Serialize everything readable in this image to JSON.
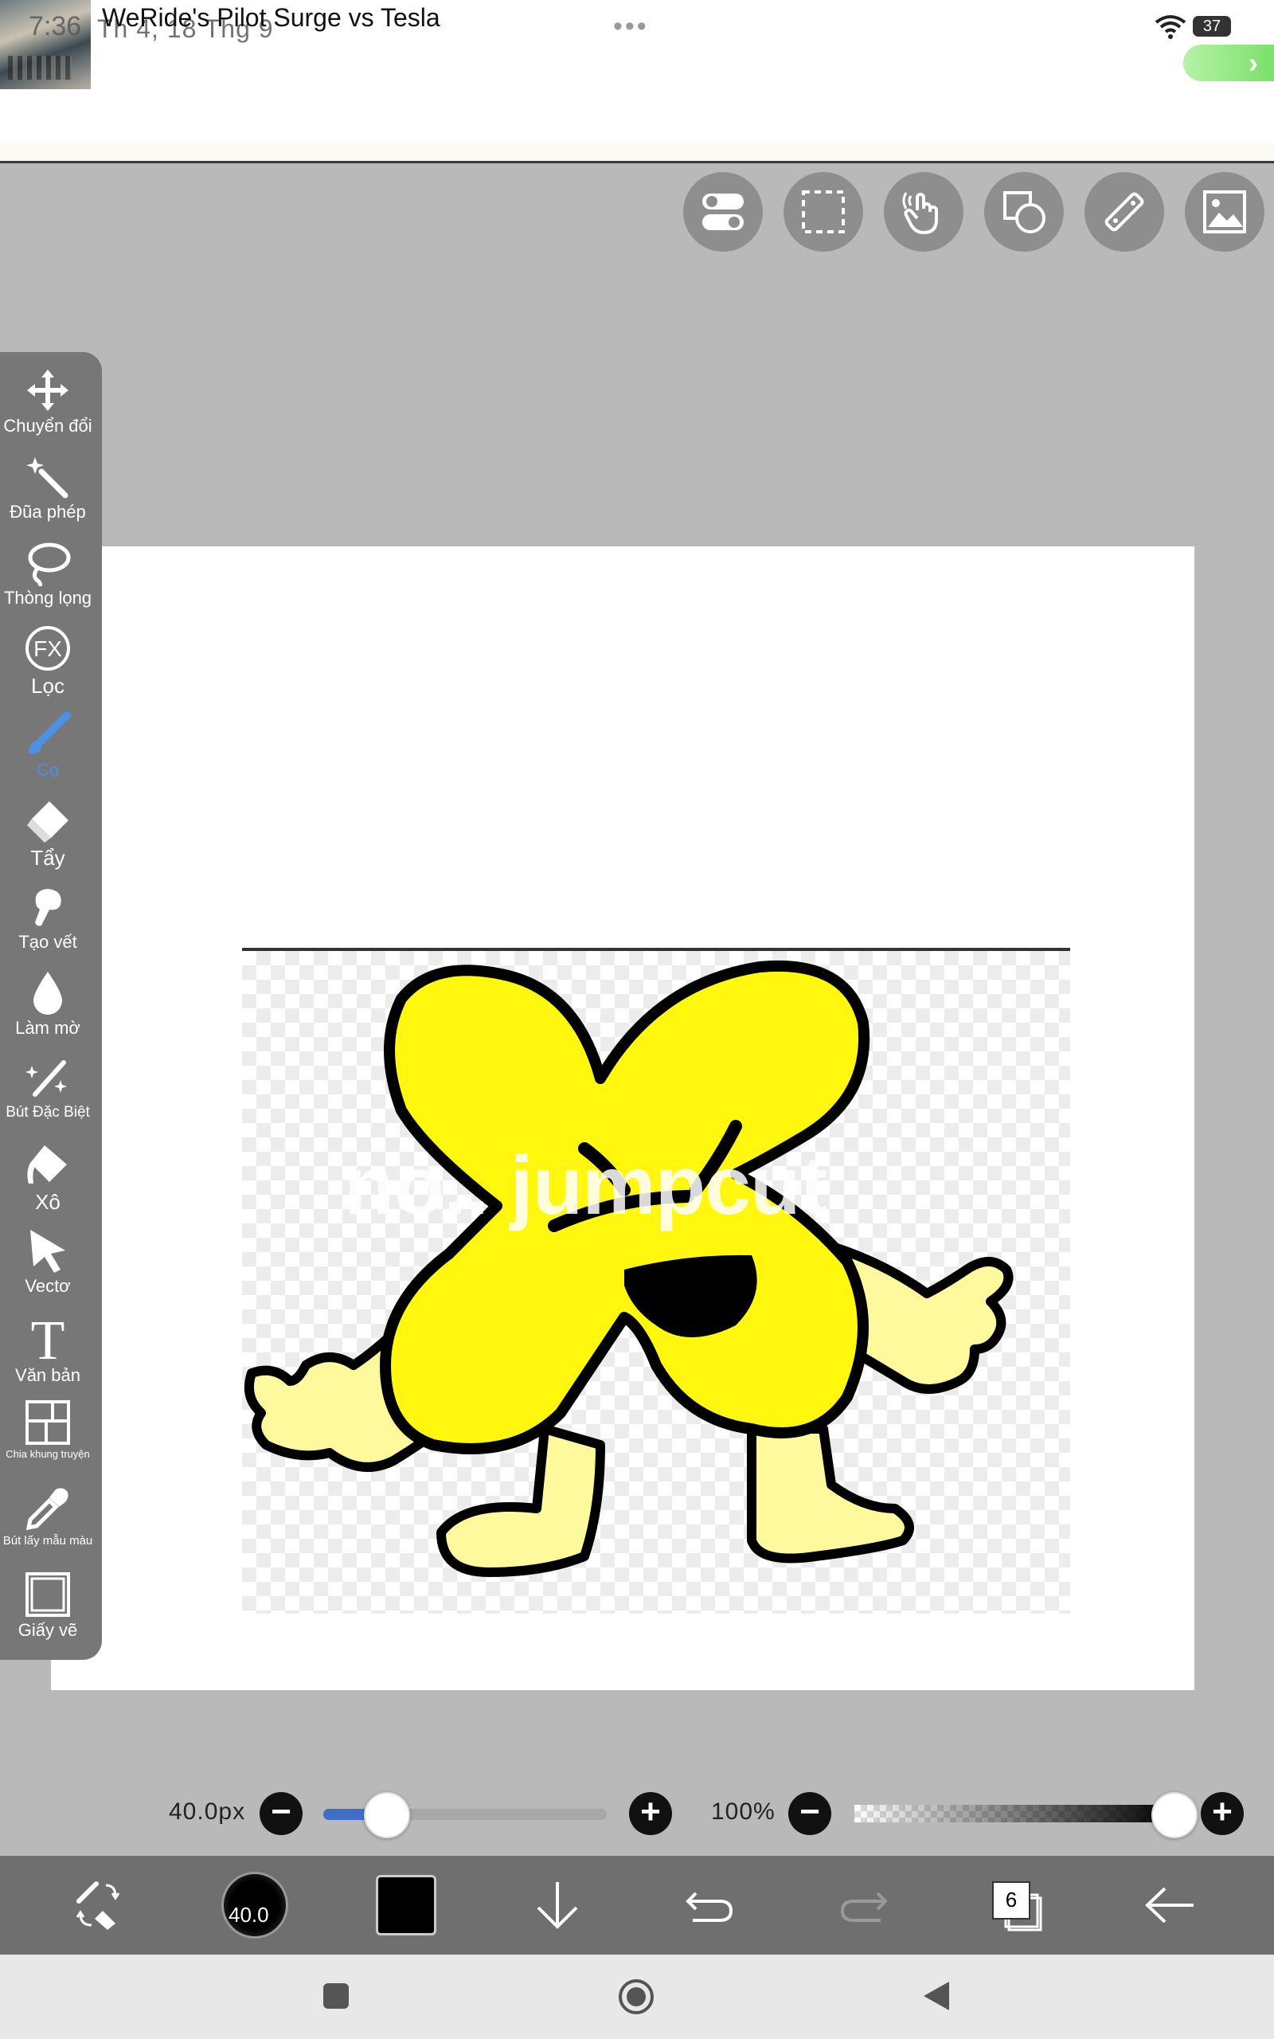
{
  "status": {
    "time": "7:36",
    "date": "Th 4, 18 Thg 9",
    "battery": "37"
  },
  "notification": {
    "title": "WeRide's Pilot Surge vs Tesla",
    "more": "•••"
  },
  "top_tools": [
    "toggle-icon",
    "selection-icon",
    "hand-icon",
    "shape-icon",
    "ruler-icon",
    "image-icon"
  ],
  "sidebar": {
    "items": [
      {
        "label": "Chuyển đổi",
        "icon": "move-icon"
      },
      {
        "label": "Đũa phép",
        "icon": "magic-wand-icon"
      },
      {
        "label": "Thòng lọng",
        "icon": "lasso-icon"
      },
      {
        "label": "Lọc",
        "icon": "fx-icon"
      },
      {
        "label": "Cọ",
        "icon": "brush-icon",
        "active": true
      },
      {
        "label": "Tẩy",
        "icon": "eraser-icon"
      },
      {
        "label": "Tạo vết",
        "icon": "smudge-icon"
      },
      {
        "label": "Làm mờ",
        "icon": "blur-icon"
      },
      {
        "label": "Bút Đặc Biệt",
        "icon": "special-pen-icon"
      },
      {
        "label": "Xô",
        "icon": "bucket-icon"
      },
      {
        "label": "Vectơ",
        "icon": "vector-icon"
      },
      {
        "label": "Văn bản",
        "icon": "text-icon"
      },
      {
        "label": "Chia khung truyện",
        "icon": "panel-icon"
      },
      {
        "label": "Bút lấy mẫu màu",
        "icon": "eyedropper-icon"
      },
      {
        "label": "Giấy vẽ",
        "icon": "canvas-icon"
      }
    ],
    "text_glyph": "T",
    "fx_glyph": "FX"
  },
  "canvas": {
    "caption": "no.. jumpcut"
  },
  "brush": {
    "size_label": "40.0px",
    "size_fraction": 0.22,
    "opacity_label": "100%",
    "opacity_fraction": 1.0,
    "minus": "−",
    "plus": "+",
    "circle_label": "40.0"
  },
  "bottom_bar": {
    "layer_count": "6",
    "color": "#000000"
  },
  "colors": {
    "accent": "#3f6ec6",
    "active_tool": "#4d8fe0",
    "character_fill": "#fff70d",
    "character_limb": "#fff99e"
  }
}
